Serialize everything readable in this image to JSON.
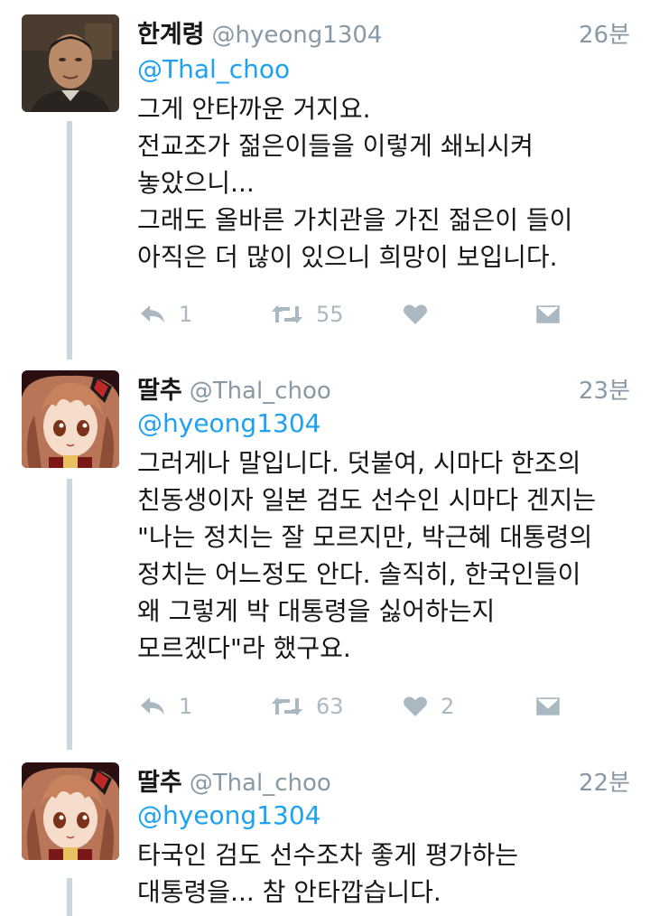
{
  "tweets": [
    {
      "name": "한계령",
      "handle": "@hyeong1304",
      "time": "26분",
      "mention": "@Thal_choo",
      "avatar_icon": "person-photo",
      "lines": [
        "그게 안타까운 거지요.",
        "전교조가 젊은이들을 이렇게 쇄뇌시켜",
        "놓았으니...",
        "그래도 올바른 가치관을 가진 젊은이 들이",
        "아직은 더 많이 있으니 희망이 보입니다."
      ],
      "replies": "1",
      "retweets": "55",
      "likes": ""
    },
    {
      "name": "딸추",
      "handle": "@Thal_choo",
      "time": "23분",
      "mention": "@hyeong1304",
      "avatar_icon": "anime-girl",
      "lines": [
        "그러게나 말입니다. 덧붙여, 시마다 한조의",
        "친동생이자 일본 검도 선수인 시마다 겐지는",
        "\"나는 정치는 잘 모르지만, 박근혜 대통령의",
        "정치는 어느정도 안다. 솔직히, 한국인들이",
        "왜 그렇게 박 대통령을 싫어하는지",
        "모르겠다\"라 했구요."
      ],
      "replies": "1",
      "retweets": "63",
      "likes": "2"
    },
    {
      "name": "딸추",
      "handle": "@Thal_choo",
      "time": "22분",
      "mention": "@hyeong1304",
      "avatar_icon": "anime-girl",
      "lines": [
        "타국인 검도 선수조차 좋게 평가하는",
        "대통령을... 참 안타깝습니다."
      ]
    }
  ],
  "colors": {
    "link": "#1da1f2",
    "muted": "#8899a6",
    "icon": "#aab8c2",
    "thread_line": "#ccd6dd"
  }
}
